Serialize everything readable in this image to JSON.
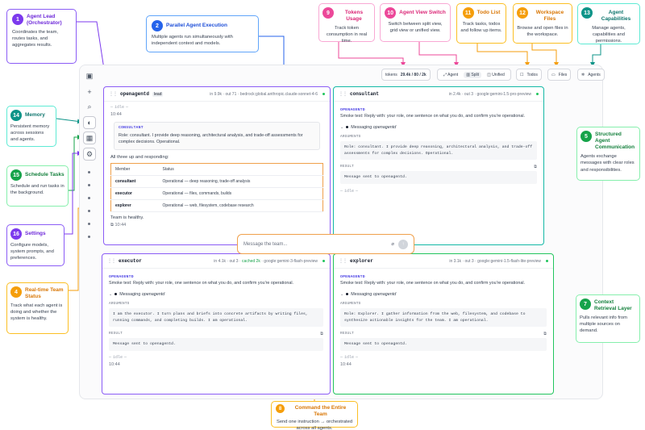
{
  "toolbar": {
    "tokens_label": "tokens",
    "tokens_value": "29.4k / 80 / 2k",
    "view_agent": "Agent",
    "view_split": "Split",
    "view_unified": "Unified",
    "todos": "Todos",
    "files": "Files",
    "agents": "Agents"
  },
  "composer": {
    "placeholder": "Message the team..."
  },
  "panels": {
    "lead": {
      "name": "openagentd",
      "badge": "lead",
      "meta": "in 9.9k · out 71 · bedrock:global.anthropic.claude-sonnet-4-6",
      "idle": "idle",
      "time1": "10:44",
      "sender": "CONSULTANT",
      "message": "Role: consultant. I provide deep reasoning, architectural analysis, and trade-off assessments for complex decisions. Operational.",
      "responding": "All three up and responding:",
      "table_header": [
        "Member",
        "Status"
      ],
      "table_rows": [
        {
          "member": "consultant",
          "status": "Operational — deep reasoning, trade-off analysis"
        },
        {
          "member": "executor",
          "status": "Operational — files, commands, builds"
        },
        {
          "member": "explorer",
          "status": "Operational — web, filesystem, codebase research"
        }
      ],
      "healthy": "Team is healthy.",
      "time2": "10:44"
    },
    "consultant": {
      "name": "consultant",
      "meta": "in 2.4k · out 3 · google:gemini-1.5-pro-preview",
      "sender": "OPENAGENTD",
      "message": "Smoke test: Reply with: your role, one sentence on what you do, and confirm you're operational.",
      "messaging_prefix": "Messaging ",
      "messaging_target": "openagentd",
      "args_label": "ARGUMENTS",
      "args": "Role: consultant. I provide deep reasoning, architectural analysis, and trade-off assessments for complex decisions. Operational.",
      "result_label": "RESULT",
      "result": "Message sent to openagentd.",
      "idle": "idle"
    },
    "executor": {
      "name": "executor",
      "meta_main": "in 4.1k · out 3 · ",
      "meta_cached": "cached 2k",
      "meta_model": " · google:gemini-3-flash-preview",
      "sender": "OPENAGENTD",
      "message": "Smoke test: Reply with: your role, one sentence on what you do, and confirm you're operational.",
      "messaging_prefix": "Messaging ",
      "messaging_target": "openagentd",
      "args_label": "ARGUMENTS",
      "args": "I am the executor. I turn plans and briefs into concrete artifacts by writing files, running commands, and completing builds. I am operational.",
      "result_label": "RESULT",
      "result": "Message sent to openagentd.",
      "idle": "idle",
      "time": "10:44"
    },
    "explorer": {
      "name": "explorer",
      "meta": "in 3.1k · out 3 · google:gemini-1.5-flash-lite-preview",
      "sender": "OPENAGENTD",
      "message": "Smoke test: Reply with: your role, one sentence on what you do, and confirm you're operational.",
      "messaging_prefix": "Messaging ",
      "messaging_target": "openagentd",
      "args_label": "ARGUMENTS",
      "args": "Role: Explorer. I gather information from the web, filesystem, and codebase to synthesize actionable insights for the team. I am operational.",
      "result_label": "RESULT",
      "result": "Message sent to openagentd.",
      "idle": "idle",
      "time": "10:44"
    }
  },
  "callouts": {
    "c1": {
      "num": "1",
      "title": "Agent Lead (Orchestrator)",
      "desc": "Coordinates the team, routes tasks, and aggregates results."
    },
    "c2": {
      "num": "2",
      "title": "Parallel Agent Execution",
      "desc": "Multiple agents run simultaneously with independent context and models."
    },
    "c4": {
      "num": "4",
      "title": "Real-time Team Status",
      "desc": "Track what each agent is doing and whether the system is healthy."
    },
    "c5": {
      "num": "5",
      "title": "Structured Agent Communication",
      "desc": "Agents exchange messages with clear roles and responsibilities."
    },
    "c7": {
      "num": "7",
      "title": "Context Retrieval Layer",
      "desc": "Pulls relevant info from multiple sources on demand."
    },
    "c8": {
      "num": "8",
      "title": "Command the Entire Team",
      "desc": "Send one instruction → orchestrated across all agents."
    },
    "c9": {
      "num": "9",
      "title": "Tokens Usage",
      "desc": "Track token consumption in real time."
    },
    "c10": {
      "num": "10",
      "title": "Agent View Switch",
      "desc": "Switch between split view, grid view or unified view."
    },
    "c11": {
      "num": "11",
      "title": "Todo List",
      "desc": "Track tasks, todos and follow up items."
    },
    "c12": {
      "num": "12",
      "title": "Workspace Files",
      "desc": "Browse and open files in the workspace."
    },
    "c13": {
      "num": "13",
      "title": "Agent Capabilities",
      "desc": "Manage agents, capabilities and permissions."
    },
    "c14": {
      "num": "14",
      "title": "Memory",
      "desc": "Persistent memory across sessions and agents."
    },
    "c15": {
      "num": "15",
      "title": "Schedule Tasks",
      "desc": "Schedule and run tasks in the background."
    },
    "c16": {
      "num": "16",
      "title": "Settings",
      "desc": "Configure models, system prompts, and preferences."
    }
  }
}
